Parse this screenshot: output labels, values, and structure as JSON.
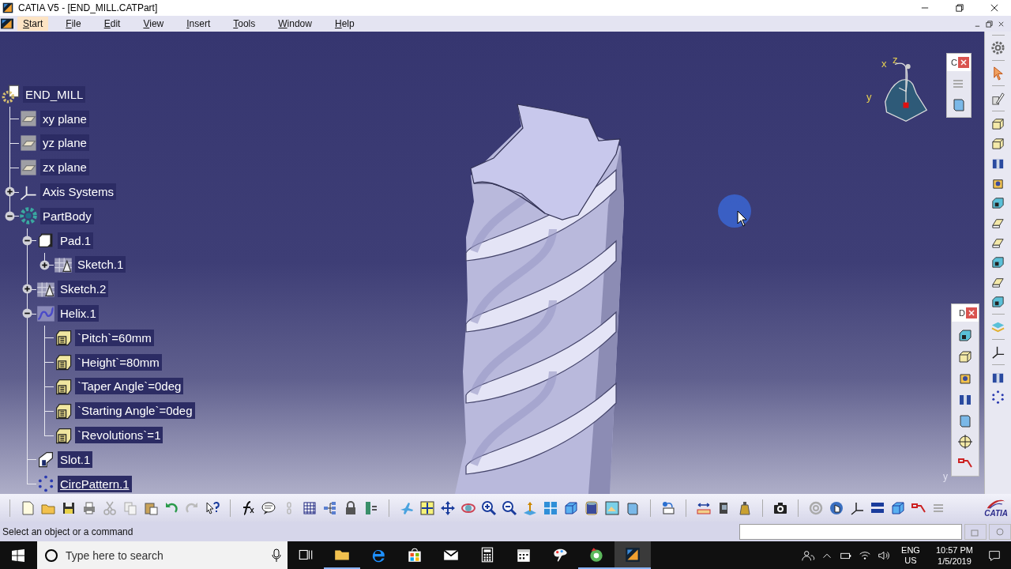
{
  "window": {
    "title": "CATIA V5 - [END_MILL.CATPart]"
  },
  "menu": [
    {
      "label": "Start",
      "selected": true
    },
    {
      "label": "File",
      "selected": false
    },
    {
      "label": "Edit",
      "selected": false
    },
    {
      "label": "View",
      "selected": false
    },
    {
      "label": "Insert",
      "selected": false
    },
    {
      "label": "Tools",
      "selected": false
    },
    {
      "label": "Window",
      "selected": false
    },
    {
      "label": "Help",
      "selected": false
    }
  ],
  "tree": {
    "root": {
      "label": "END_MILL",
      "kind": "part",
      "current": false,
      "children": [
        {
          "label": "xy plane",
          "kind": "plane",
          "current": false
        },
        {
          "label": "yz plane",
          "kind": "plane",
          "current": false
        },
        {
          "label": "zx plane",
          "kind": "plane",
          "current": false
        },
        {
          "label": "Axis Systems",
          "kind": "axis",
          "current": false,
          "expanded": false
        },
        {
          "label": "PartBody",
          "kind": "body",
          "current": false,
          "expanded": true,
          "children": [
            {
              "label": "Pad.1",
              "kind": "pad",
              "current": false,
              "expanded": true,
              "children": [
                {
                  "label": "Sketch.1",
                  "kind": "sketch",
                  "current": false,
                  "expanded": false
                }
              ]
            },
            {
              "label": "Sketch.2",
              "kind": "sketch",
              "current": false,
              "expanded": false
            },
            {
              "label": "Helix.1",
              "kind": "helix",
              "current": false,
              "expanded": true,
              "children": [
                {
                  "label": "`Pitch`=60mm",
                  "kind": "parameter",
                  "current": false
                },
                {
                  "label": "`Height`=80mm",
                  "kind": "parameter",
                  "current": false
                },
                {
                  "label": "`Taper Angle`=0deg",
                  "kind": "parameter",
                  "current": false
                },
                {
                  "label": "`Starting Angle`=0deg",
                  "kind": "parameter",
                  "current": false
                },
                {
                  "label": "`Revolutions`=1",
                  "kind": "parameter",
                  "current": false
                }
              ]
            },
            {
              "label": "Slot.1",
              "kind": "slot",
              "current": false
            },
            {
              "label": "CircPattern.1",
              "kind": "pattern",
              "current": true
            }
          ]
        }
      ]
    }
  },
  "compass": {
    "labels": [
      "x",
      "z",
      "y"
    ]
  },
  "corner_axis_label": "y",
  "floating_toolbars": [
    {
      "title": "C"
    },
    {
      "title": "D"
    }
  ],
  "brand_logo": "CATIA",
  "status_bar": {
    "message": "Select an object or a command"
  },
  "taskbar": {
    "search_placeholder": "Type here to search",
    "apps": [
      {
        "kind": "task-view",
        "open": false,
        "selected": false
      },
      {
        "kind": "folder",
        "open": true,
        "selected": false
      },
      {
        "kind": "browser",
        "open": false,
        "selected": false
      },
      {
        "kind": "store",
        "open": false,
        "selected": false
      },
      {
        "kind": "mail",
        "open": false,
        "selected": false
      },
      {
        "kind": "calculator",
        "open": false,
        "selected": false
      },
      {
        "kind": "calendar",
        "open": false,
        "selected": false
      },
      {
        "kind": "paint",
        "open": false,
        "selected": false
      },
      {
        "kind": "green-app",
        "open": true,
        "selected": false
      },
      {
        "kind": "catia",
        "open": true,
        "selected": true
      }
    ],
    "language": "ENG",
    "region": "US",
    "time": "10:57 PM",
    "date": "1/5/2019"
  }
}
